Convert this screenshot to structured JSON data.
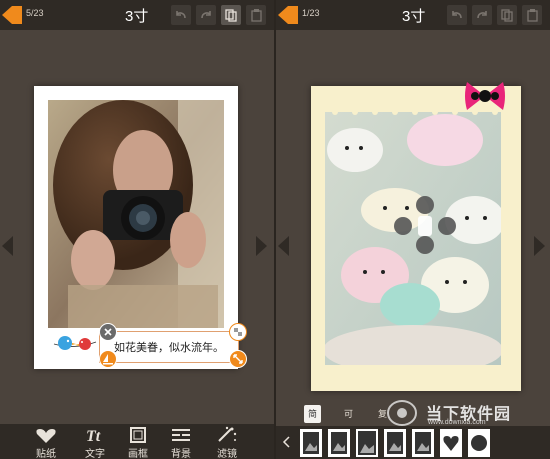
{
  "left": {
    "counter": "5/23",
    "title": "3寸",
    "caption": "如花美眷，似水流年。",
    "tools": [
      {
        "label": "贴纸",
        "icon": "heart-sticker-icon"
      },
      {
        "label": "文字",
        "icon": "text-tt-icon"
      },
      {
        "label": "画框",
        "icon": "frame-icon"
      },
      {
        "label": "背景",
        "icon": "background-icon"
      },
      {
        "label": "滤镜",
        "icon": "filter-sparkle-icon"
      }
    ]
  },
  "right": {
    "counter": "1/23",
    "title": "3寸",
    "tabs": [
      {
        "label": "简约",
        "selected": true
      },
      {
        "label": "可爱",
        "selected": false
      },
      {
        "label": "复古",
        "selected": false
      }
    ]
  },
  "watermark": {
    "text": "当下软件园",
    "url": "www.downxia.com"
  },
  "colors": {
    "accent": "#f08a1c",
    "background": "#4b433c",
    "bar": "#2f2a25",
    "cream_frame": "#f8f0cc"
  }
}
